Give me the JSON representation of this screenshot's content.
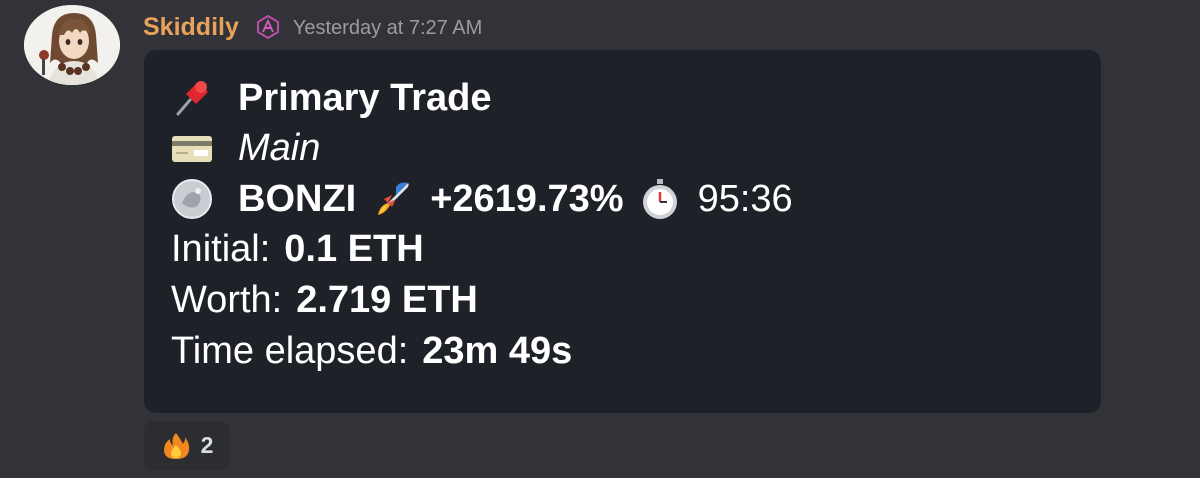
{
  "author": {
    "username": "Skiddily",
    "role_icon": "gem-role-icon",
    "timestamp": "Yesterday at 7:27 AM",
    "avatar": "anime-character-avatar"
  },
  "card": {
    "title": "Primary Trade",
    "title_icon": "pushpin-icon",
    "account": "Main",
    "account_icon": "credit-card-icon",
    "token_icon": "coin-icon",
    "token": "BONZI",
    "token_trend_icon": "rocket-icon",
    "change": "+2619.73%",
    "timer_icon": "stopwatch-icon",
    "timer": "95:36",
    "initial_label": "Initial:",
    "initial_value": "0.1 ETH",
    "worth_label": "Worth:",
    "worth_value": "2.719 ETH",
    "elapsed_label": "Time elapsed:",
    "elapsed_value": "23m 49s"
  },
  "reactions": [
    {
      "emoji": "fire-icon",
      "count": "2"
    }
  ],
  "colors": {
    "background": "#313338",
    "card_background": "#1e2228",
    "username": "#e8a25b",
    "timestamp": "#9b9ca3",
    "text": "#ffffff"
  }
}
